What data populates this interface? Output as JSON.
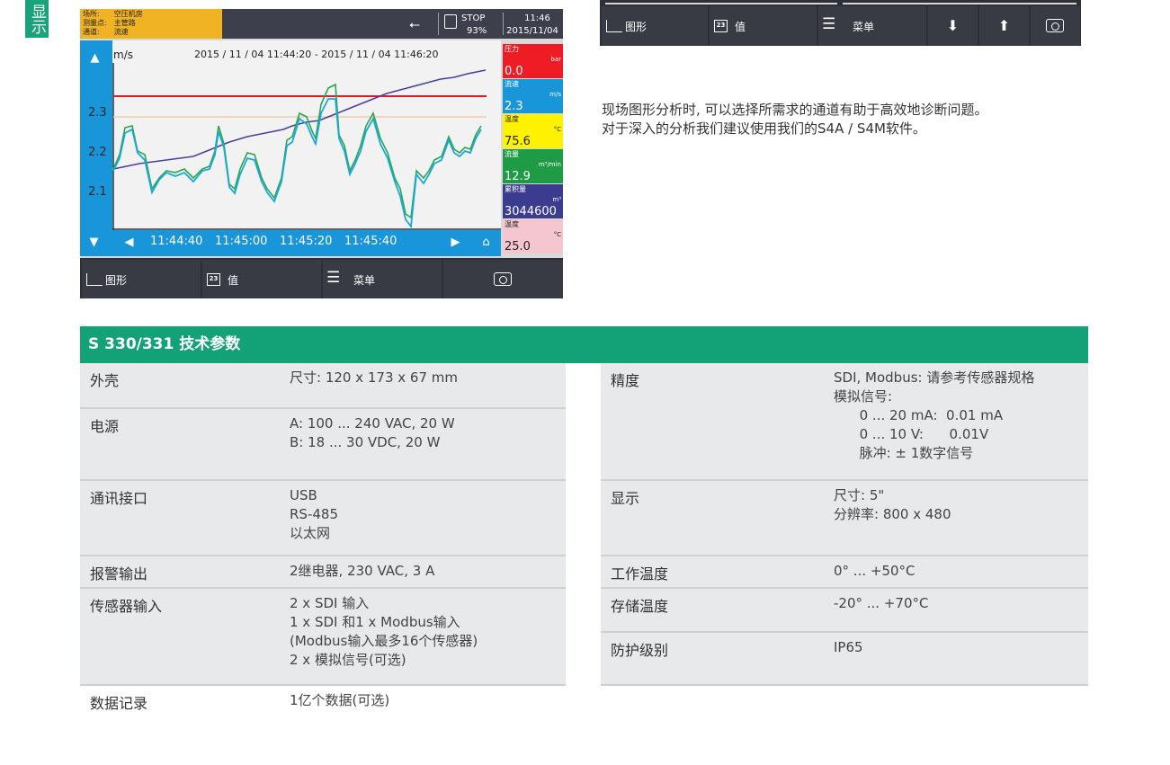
{
  "side_tab": "显示",
  "device": {
    "location_lines": [
      "场所:　　空压机房",
      "测量点:　主管路",
      "通道:　　流速"
    ],
    "status": {
      "stop": "STOP",
      "memory": "93%",
      "time": "11:46",
      "date": "2015/11/04"
    },
    "unit": "m/s",
    "time_range": "2015 / 11 / 04 11:44:20 - 2015 / 11 / 04 11:46:20",
    "y_ticks": [
      "2.3",
      "2.2",
      "2.1"
    ],
    "x_ticks": [
      "11:44:40",
      "11:45:00",
      "11:45:20",
      "11:45:40"
    ],
    "channels": [
      {
        "name": "压力",
        "unit": "bar",
        "value": "0.0",
        "color": "#ee1c25",
        "text_color": "#ffffff"
      },
      {
        "name": "流速",
        "unit": "m/s",
        "value": "2.3",
        "color": "#1996d9",
        "text_color": "#ffffff"
      },
      {
        "name": "温度",
        "unit": "°C",
        "value": "75.6",
        "color": "#fff200",
        "text_color": "#222222"
      },
      {
        "name": "流量",
        "unit": "m³/min",
        "value": "12.9",
        "color": "#1f9a45",
        "text_color": "#ffffff"
      },
      {
        "name": "累积量",
        "unit": "m³",
        "value": "3044600",
        "color": "#3b3b8f",
        "text_color": "#ffffff"
      },
      {
        "name": "温度",
        "unit": "°C",
        "value": "25.0",
        "color": "#f5c6cf",
        "text_color": "#222222"
      }
    ],
    "buttons": {
      "graph": "图形",
      "values": "值",
      "menu": "菜单"
    }
  },
  "toolbar2": {
    "graph": "图形",
    "values": "值",
    "menu": "菜单"
  },
  "description": [
    "现场图形分析时, 可以选择所需求的通道有助于高效地诊断问题。",
    "对于深入的分析我们建议使用我们的S4A / S4M软件。"
  ],
  "spec": {
    "title": "S 330/331 技术参数",
    "left": [
      {
        "label": "外壳",
        "value": "尺寸: 120 x 173 x 67 mm"
      },
      {
        "label": "电源",
        "value": "A: 100 ... 240 VAC, 20 W\nB: 18 ... 30 VDC, 20 W"
      },
      {
        "label": "通讯接口",
        "value": "USB\nRS-485\n以太网"
      },
      {
        "label": "报警输出",
        "value": "2继电器, 230 VAC, 3 A"
      },
      {
        "label": "传感器输入",
        "value": "2 x SDI 输入\n1 x SDI 和1 x Modbus输入\n(Modbus输入最多16个传感器)\n2 x 模拟信号(可选)"
      },
      {
        "label": "数据记录",
        "value": "1亿个数据(可选)"
      }
    ],
    "right": [
      {
        "label": "精度",
        "value": "SDI, Modbus: 请参考传感器规格\n模拟信号:\n      0 ... 20 mA:  0.01 mA\n      0 ... 10 V:      0.01V\n      脉冲: ± 1数字信号"
      },
      {
        "label": "显示",
        "value": "尺寸: 5\"\n分辨率: 800 x 480"
      },
      {
        "label": "工作温度",
        "value": "0° ... +50°C"
      },
      {
        "label": "存储温度",
        "value": "-20° ... +70°C"
      },
      {
        "label": "防护级别",
        "value": "IP65"
      }
    ]
  }
}
